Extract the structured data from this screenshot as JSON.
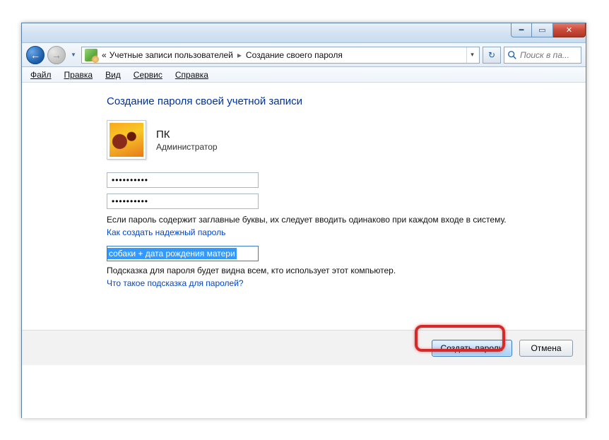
{
  "titlebar": {
    "minimize_glyph": "━",
    "maximize_glyph": "▭",
    "close_glyph": "✕"
  },
  "nav": {
    "back_glyph": "←",
    "forward_glyph": "→",
    "chevron": "▼",
    "refresh_glyph": "↻"
  },
  "breadcrumb": {
    "prefix": "«",
    "seg1": "Учетные записи пользователей",
    "seg2": "Создание своего пароля",
    "arrow": "▸",
    "drop": "▾"
  },
  "search": {
    "placeholder": "Поиск в па..."
  },
  "menu": {
    "file": "Файл",
    "edit": "Правка",
    "view": "Вид",
    "tools": "Сервис",
    "help": "Справка"
  },
  "page": {
    "title": "Создание пароля своей учетной записи",
    "user_name": "ПК",
    "user_role": "Администратор",
    "password1": "••••••••••",
    "password2": "••••••••••",
    "caps_note": "Если пароль содержит заглавные буквы, их следует вводить одинаково при каждом входе в систему.",
    "strong_link": "Как создать надежный пароль",
    "hint_value": "собаки + дата рождения матери",
    "hint_note": "Подсказка для пароля будет видна всем, кто использует этот компьютер.",
    "hint_link": "Что такое подсказка для паролей?"
  },
  "footer": {
    "create": "Создать пароль",
    "cancel": "Отмена"
  }
}
